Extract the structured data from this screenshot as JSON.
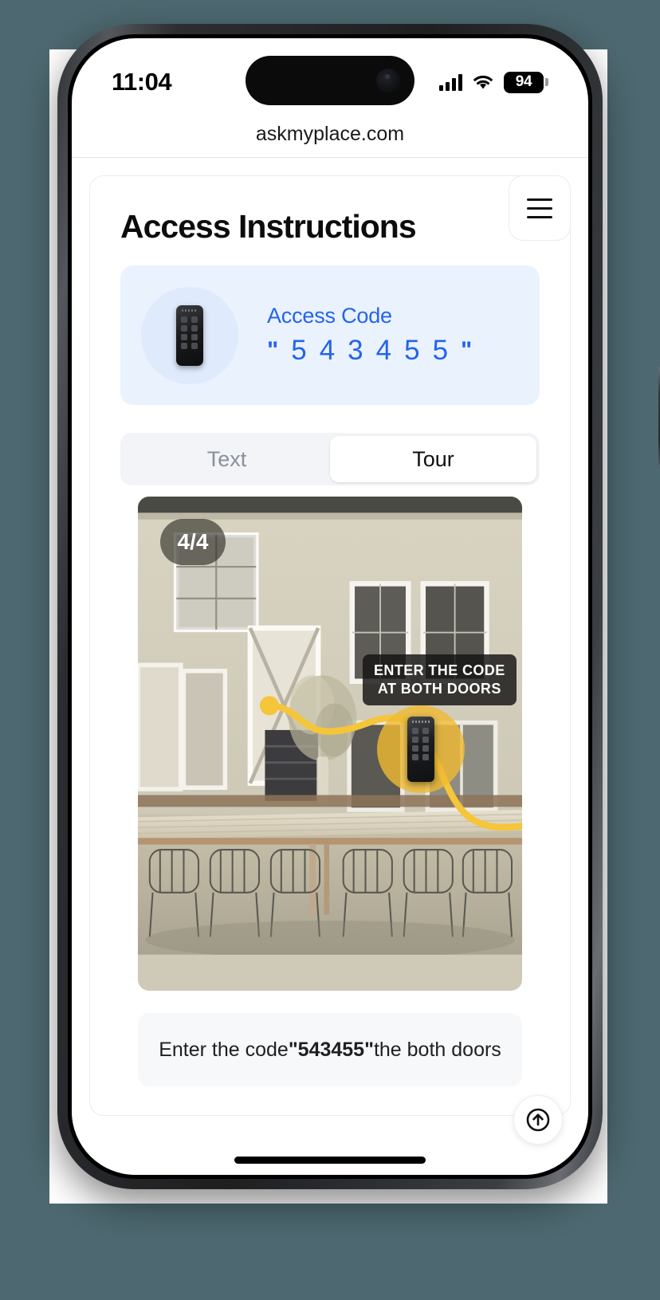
{
  "status_bar": {
    "time": "11:04",
    "signal_icon": "cellular-bars-icon",
    "wifi_icon": "wifi-icon",
    "battery_level": "94"
  },
  "browser": {
    "url": "askmyplace.com"
  },
  "header": {
    "title": "Access Instructions",
    "menu_icon": "hamburger-menu-icon"
  },
  "access_card": {
    "icon": "keypad-lock-icon",
    "label": "Access Code",
    "quote_open": "\"",
    "quote_close": "\"",
    "digits": [
      "5",
      "4",
      "3",
      "4",
      "5",
      "5"
    ],
    "code": "543455",
    "accent_color": "#2563eb",
    "background_color": "#eaf2fe"
  },
  "tabs": {
    "items": [
      {
        "label": "Text",
        "active": false
      },
      {
        "label": "Tour",
        "active": true
      }
    ]
  },
  "tour": {
    "step_badge": "4/4",
    "callout_line1": "ENTER THE CODE",
    "callout_line2": "AT BOTH DOORS",
    "spotlight_icon": "keypad-lock-icon",
    "spotlight_color": "#f0ba31",
    "path_color": "#f5c53a"
  },
  "caption": {
    "prefix": "Enter the code ",
    "code": "\"543455\"",
    "suffix": " the both doors"
  },
  "footer": {
    "scroll_top_icon": "arrow-up-circle-icon"
  }
}
